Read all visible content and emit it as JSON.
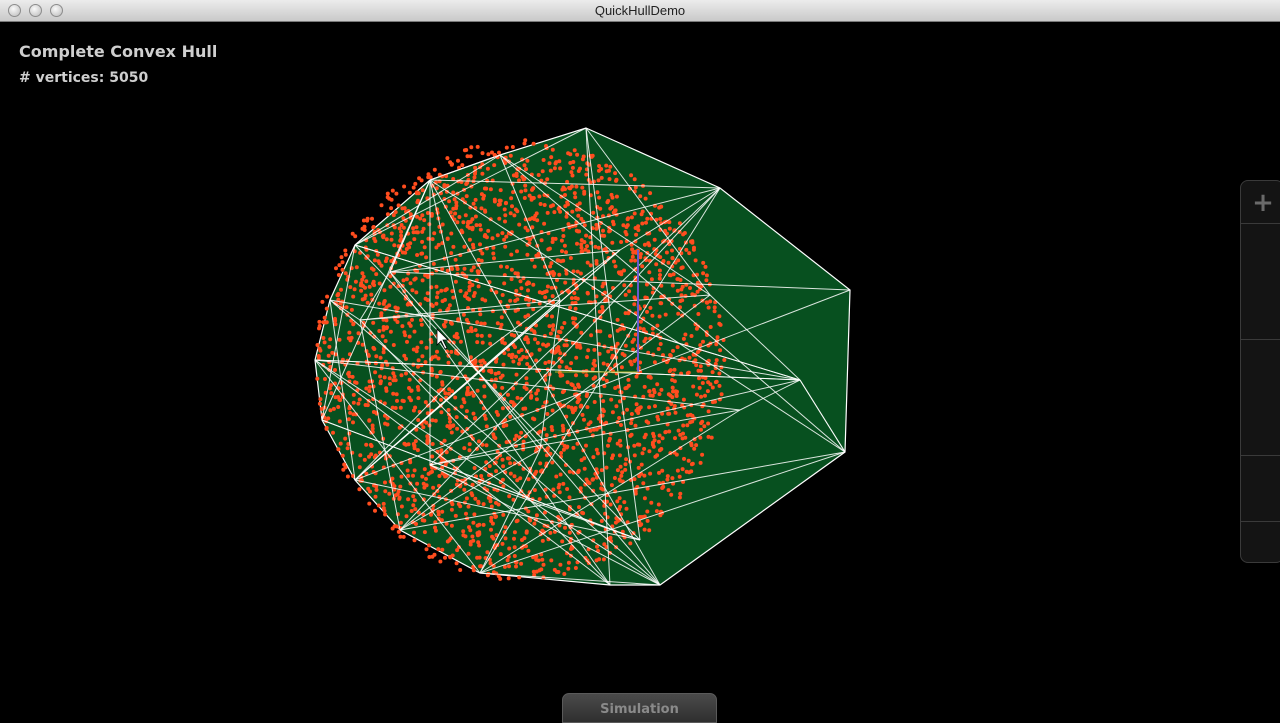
{
  "window": {
    "title": "QuickHullDemo"
  },
  "hud": {
    "title": "Complete Convex Hull",
    "vertex_count_label": "# vertices: 5050"
  },
  "viewport": {
    "hull_fill_color": "#07501f",
    "edge_color": "#ffffff",
    "point_color": "#ff4d1e",
    "background": "#000000"
  },
  "side_panel": {
    "add_icon": "plus-icon"
  },
  "bottom_tab": {
    "label": "Simulation"
  }
}
